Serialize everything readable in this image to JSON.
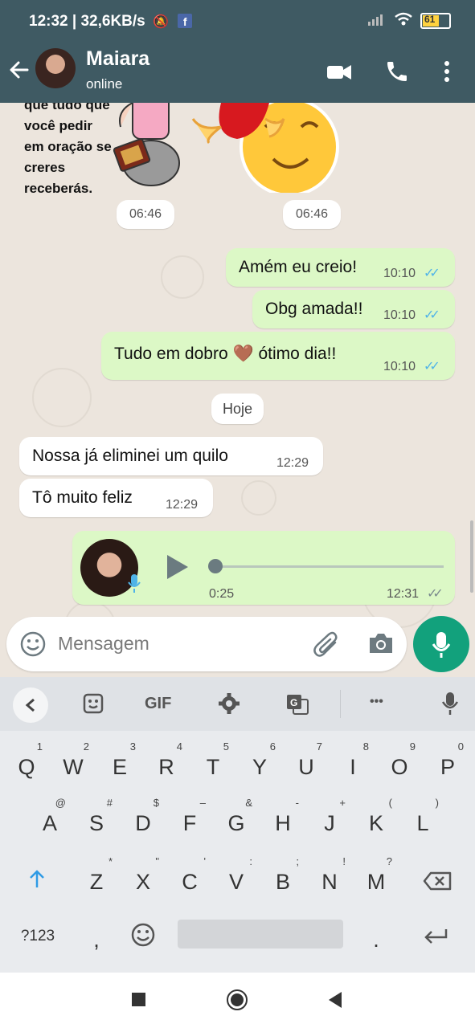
{
  "status_bar": {
    "time": "12:32 | 32,6KB/s",
    "battery": "61"
  },
  "header": {
    "back_icon": "arrow-left-icon",
    "contact_name": "Maiara",
    "contact_status": "online"
  },
  "messages": [
    {
      "text": "Amém eu creio!",
      "time": "10:10",
      "dir": "out",
      "read": true
    },
    {
      "text": "Obg amada!!",
      "time": "10:10",
      "dir": "out",
      "read": true
    },
    {
      "text": "Tudo em dobro 🤎 ótimo dia!!",
      "time": "10:10",
      "dir": "out",
      "read": true
    },
    {
      "text": "Nossa já eliminei um quilo",
      "time": "12:29",
      "dir": "in"
    },
    {
      "text": "Tô muito feliz",
      "time": "12:29",
      "dir": "in"
    }
  ],
  "sticker1": {
    "lines": [
      "que tudo que",
      "você pedir",
      "em oração se",
      "creres",
      "receberás."
    ],
    "time": "06:46"
  },
  "sticker2": {
    "time": "06:46"
  },
  "date_separator": "Hoje",
  "voice_message": {
    "duration": "0:25",
    "time": "12:31",
    "progress": 0
  },
  "composer": {
    "placeholder": "Mensagem"
  },
  "keyboard": {
    "toolbar_gif": "GIF",
    "toolbar_more": "•••",
    "row1": [
      [
        "Q",
        "1"
      ],
      [
        "W",
        "2"
      ],
      [
        "E",
        "3"
      ],
      [
        "R",
        "4"
      ],
      [
        "T",
        "5"
      ],
      [
        "Y",
        "6"
      ],
      [
        "U",
        "7"
      ],
      [
        "I",
        "8"
      ],
      [
        "O",
        "9"
      ],
      [
        "P",
        "0"
      ]
    ],
    "row2": [
      [
        "A",
        "@"
      ],
      [
        "S",
        "#"
      ],
      [
        "D",
        "$"
      ],
      [
        "F",
        "–"
      ],
      [
        "G",
        "&"
      ],
      [
        "H",
        "-"
      ],
      [
        "J",
        "+"
      ],
      [
        "K",
        "("
      ],
      [
        "L",
        ")"
      ]
    ],
    "row3": [
      [
        "Z",
        "*"
      ],
      [
        "X",
        "\""
      ],
      [
        "C",
        "'"
      ],
      [
        "V",
        ":"
      ],
      [
        "B",
        ";"
      ],
      [
        "N",
        "!"
      ],
      [
        "M",
        "?"
      ]
    ],
    "sym_key": "?123",
    "comma_key": ",",
    "period_key": "."
  }
}
